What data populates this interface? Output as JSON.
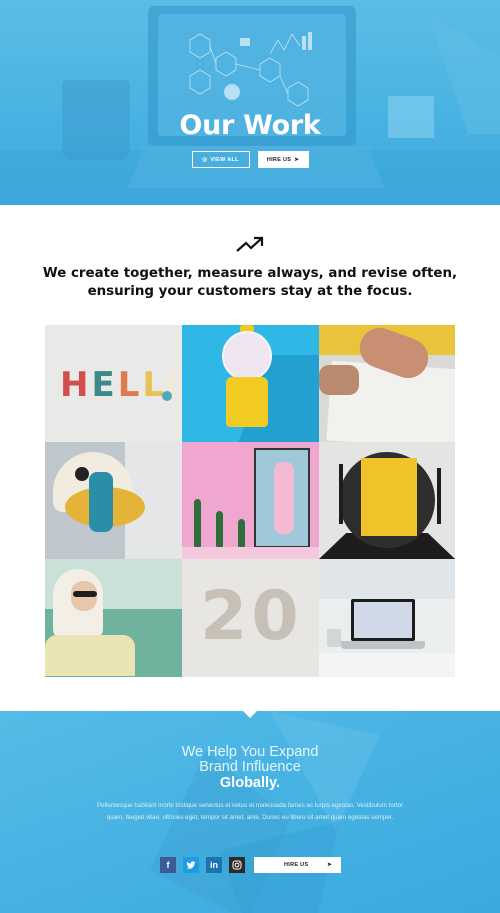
{
  "hero": {
    "title": "Our Work",
    "view_all_label": "VIEW ALL",
    "hire_us_label": "HIRE US"
  },
  "intro": {
    "headline": "We create together, measure always, and revise often, ensuring your customers stay at the focus."
  },
  "gallery": {
    "hello_text": [
      "H",
      "E",
      "L",
      "L",
      "O"
    ],
    "twenty_text": "20"
  },
  "footer": {
    "heading_line1": "We Help You Expand",
    "heading_line2": "Brand Influence",
    "heading_bold": "Globally.",
    "paragraph": "Pellentesque habitant morbi tristique senectus et netus et malesuada fames ac turpis egestas. Vestibulum tortor quam, feugiat vitae, ultricies eget, tempor sit amet, ante. Donec eu libero sit amet quam egestas semper.",
    "hire_us_label": "HIRE US",
    "social": [
      "f",
      "t",
      "in",
      "ig"
    ]
  },
  "colors": {
    "accent": "#47b2e2",
    "facebook": "#3a5a98",
    "twitter": "#1c9ce8",
    "linkedin": "#1a74ae",
    "instagram": "#2b2b2b"
  }
}
